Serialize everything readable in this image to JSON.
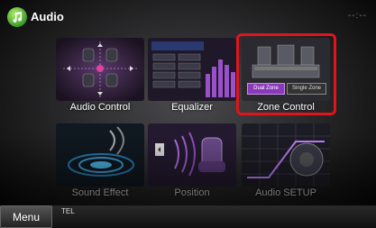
{
  "header": {
    "title": "Audio",
    "clock": "--:--"
  },
  "tiles": [
    {
      "label": "Audio Control"
    },
    {
      "label": "Equalizer"
    },
    {
      "label": "Zone Control",
      "buttons": [
        "Dual Zone",
        "Single Zone"
      ]
    },
    {
      "label": "Sound Effect"
    },
    {
      "label": "Position"
    },
    {
      "label": "Audio SETUP"
    }
  ],
  "footer": {
    "menu_label": "Menu",
    "tel_label": "TEL"
  },
  "colors": {
    "highlight": "#e0141c",
    "accent_purple": "#a050d0"
  }
}
